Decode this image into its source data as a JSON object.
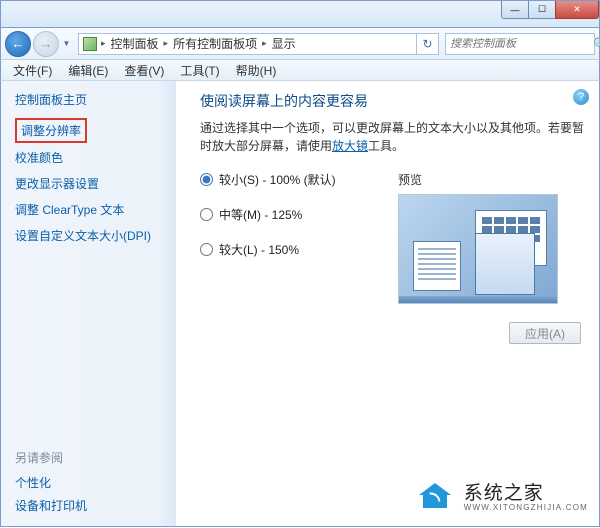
{
  "window": {
    "min": "—",
    "max": "☐",
    "close": "✕"
  },
  "nav": {
    "back": "←",
    "forward": "→",
    "dropdown": "▼",
    "breadcrumb": {
      "sep": "▸",
      "item1": "控制面板",
      "item2": "所有控制面板项",
      "item3": "显示"
    },
    "refresh": "↻",
    "search_placeholder": "搜索控制面板",
    "search_icon": "🔍"
  },
  "menu": {
    "file": "文件(F)",
    "edit": "编辑(E)",
    "view": "查看(V)",
    "tools": "工具(T)",
    "help": "帮助(H)"
  },
  "sidebar": {
    "home": "控制面板主页",
    "items": [
      "调整分辨率",
      "校准颜色",
      "更改显示器设置",
      "调整 ClearType 文本",
      "设置自定义文本大小(DPI)"
    ],
    "seealso": "另请参阅",
    "bottom": [
      "个性化",
      "设备和打印机"
    ]
  },
  "content": {
    "heading": "使阅读屏幕上的内容更容易",
    "desc_before": "通过选择其中一个选项，可以更改屏幕上的文本大小以及其他项。若要暂时放大部分屏幕，请使用",
    "desc_link": "放大镜",
    "desc_after": "工具。",
    "options": [
      "较小(S) - 100% (默认)",
      "中等(M) - 125%",
      "较大(L) - 150%"
    ],
    "preview_label": "预览",
    "apply": "应用(A)"
  },
  "watermark": {
    "cn": "系统之家",
    "en": "WWW.XITONGZHIJIA.COM"
  }
}
